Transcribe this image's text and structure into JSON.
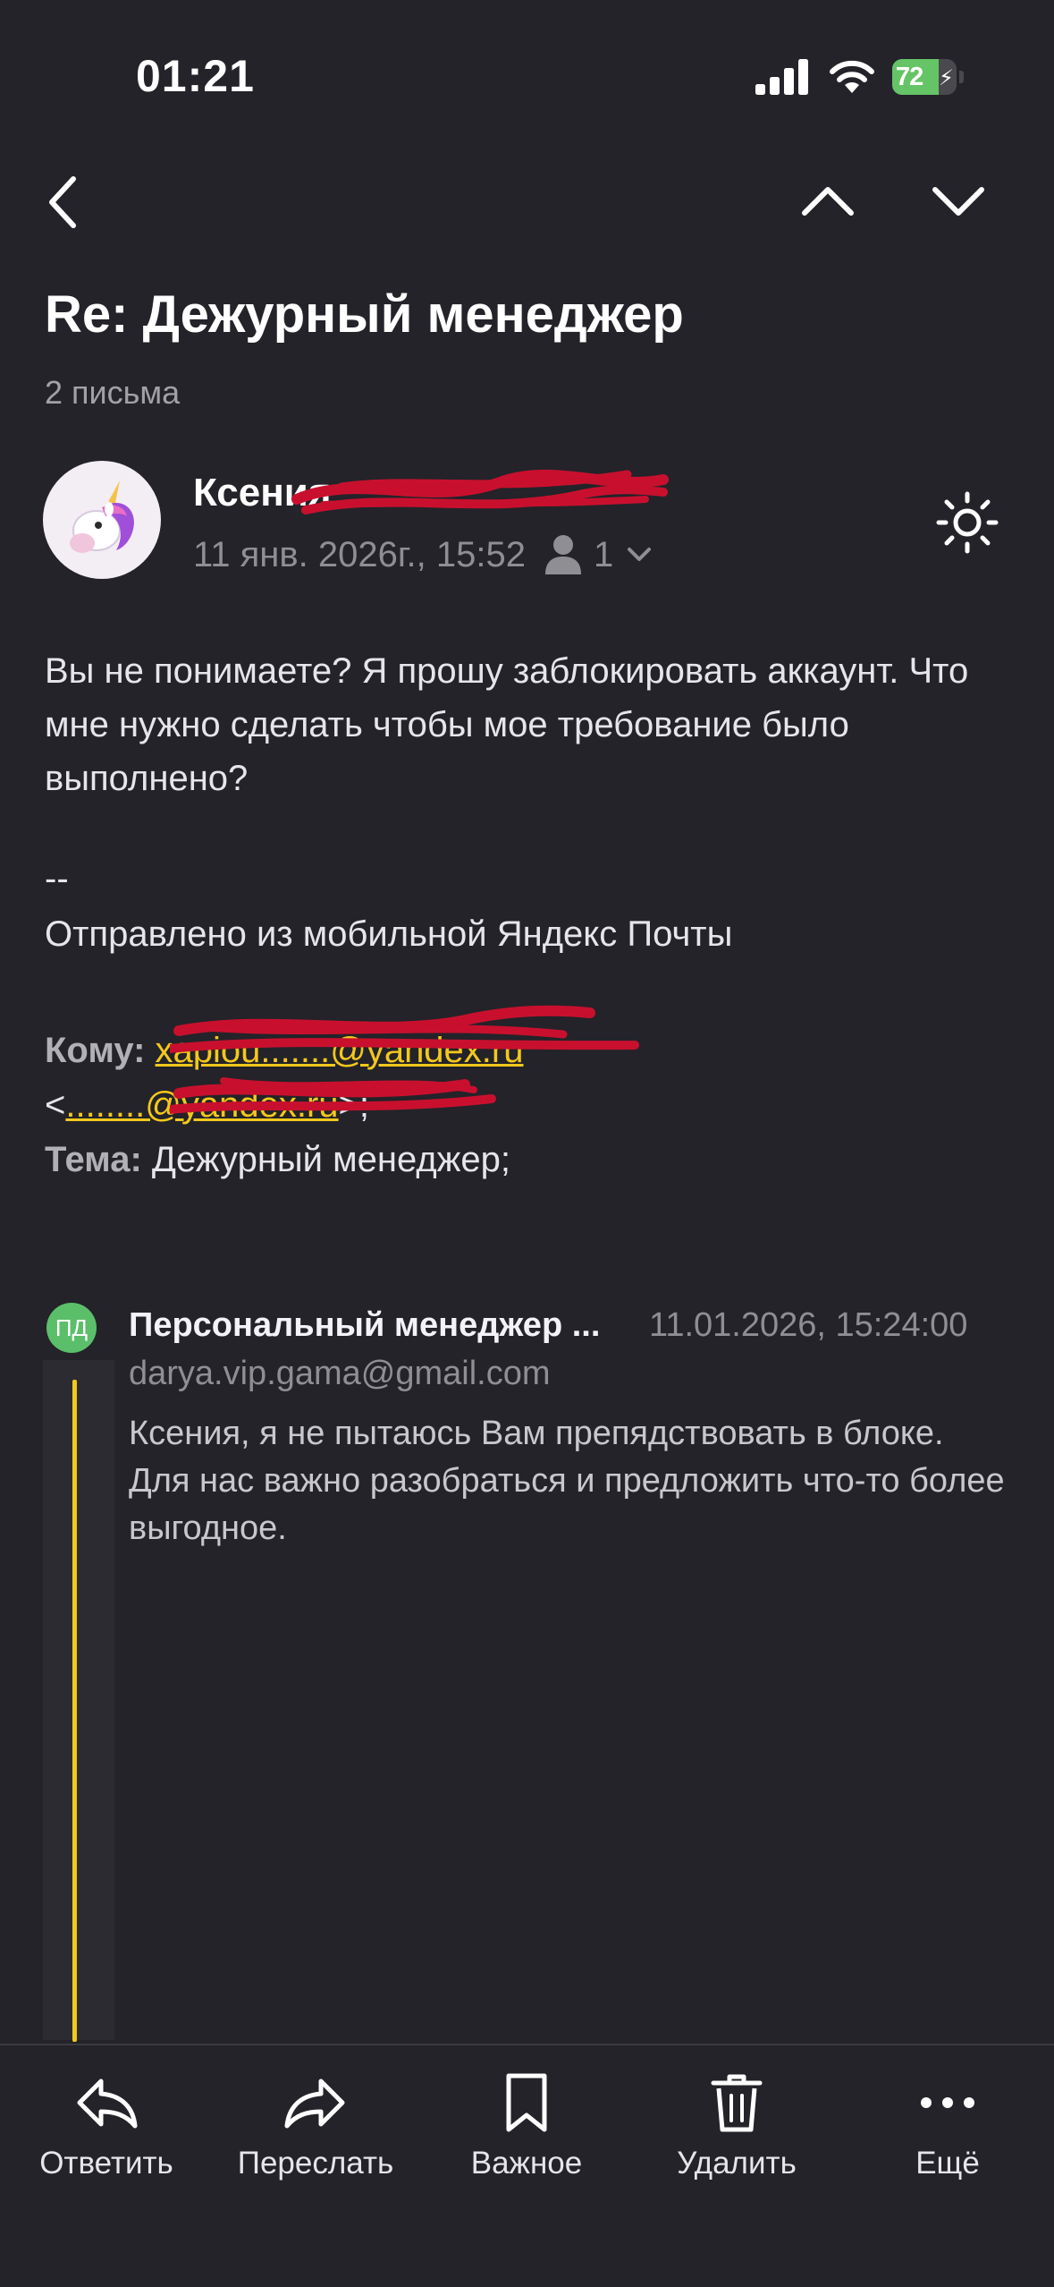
{
  "status_bar": {
    "time": "01:21",
    "battery_level": "72",
    "battery_fraction": 0.72,
    "charging": true,
    "accent_green": "#65c466"
  },
  "nav": {
    "back_icon": "chevron-left-icon",
    "prev_icon": "chevron-up-icon",
    "next_icon": "chevron-down-icon"
  },
  "thread": {
    "subject": "Re: Дежурный менеджер",
    "count_label": "2 письма"
  },
  "message": {
    "sender_name": "Ксения",
    "datetime": "11 янв. 2026г., 15:52",
    "recipient_count": "1",
    "avatar_icon": "unicorn-avatar-icon",
    "theme_icon": "sun-icon",
    "body": "Вы не понимаете? Я прошу заблокировать аккаунт. Что мне нужно сделать чтобы мое требование было выполнено?",
    "signature_dash": "--",
    "signature": "Отправлено из мобильной Яндекс Почты",
    "to_label": "Кому:",
    "to_email": "xapiou.......@yandex.ru",
    "to_open": "<",
    "to_email2": "........@yandex.ru",
    "to_close": ">;",
    "theme_label": "Тема:",
    "theme_value": "Дежурный менеджер;"
  },
  "quoted": {
    "initials": "ПД",
    "name": "Персональный менеджер ...",
    "date": "11.01.2026, 15:24:00",
    "email": "darya.vip.gama@gmail.com",
    "body": "Ксения, я не пытаюсь Вам препядствовать в блоке. Для нас важно разобраться и предложить что-то более выгодное.",
    "bar_color": "#f3c81b"
  },
  "toolbar": {
    "reply": "Ответить",
    "forward": "Переслать",
    "important": "Важное",
    "delete": "Удалить",
    "more": "Ещё"
  }
}
